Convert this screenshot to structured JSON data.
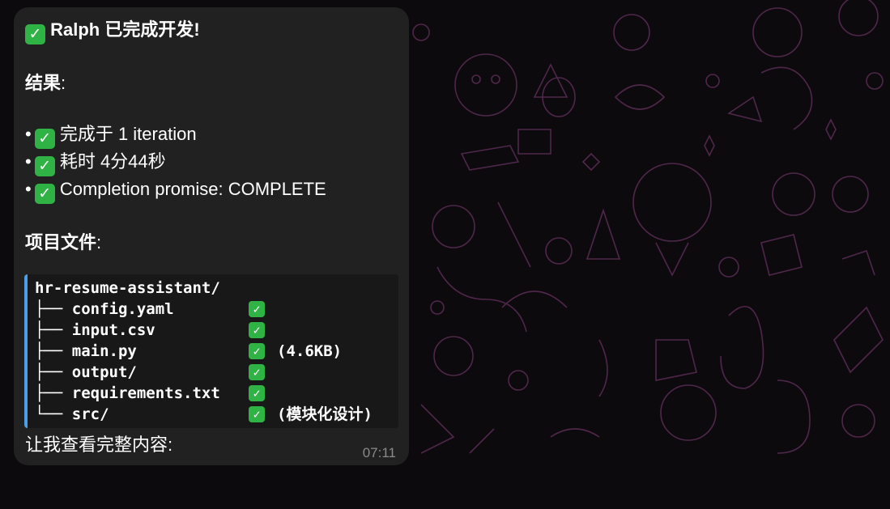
{
  "message": {
    "title": "Ralph 已完成开发!",
    "results_label": "结果",
    "results_colon": ":",
    "bullet_symbol": "•",
    "results": [
      "完成于 1 iteration",
      "耗时 4分44秒",
      "Completion promise: COMPLETE"
    ],
    "files_label": "项目文件",
    "files_colon": ":",
    "code_block": {
      "root": "hr-resume-assistant/",
      "entries": [
        {
          "prefix": "├── ",
          "name": "config.yaml",
          "note": ""
        },
        {
          "prefix": "├── ",
          "name": "input.csv",
          "note": ""
        },
        {
          "prefix": "├── ",
          "name": "main.py",
          "note": "(4.6KB)"
        },
        {
          "prefix": "├── ",
          "name": "output/",
          "note": ""
        },
        {
          "prefix": "├── ",
          "name": "requirements.txt",
          "note": ""
        },
        {
          "prefix": "└── ",
          "name": "src/",
          "note": "(模块化设计)"
        }
      ]
    },
    "closing_text": "让我查看完整内容:",
    "timestamp": "07:11"
  },
  "icons": {
    "check": "check-mark-icon"
  },
  "colors": {
    "wallpaper": "#0d0a0d",
    "doodle": "#5a2d55",
    "bubble": "#212121",
    "code_bg": "#181818",
    "code_border": "#4a9fe8",
    "check_green": "#2fb344",
    "timestamp": "#8a8a8a"
  }
}
